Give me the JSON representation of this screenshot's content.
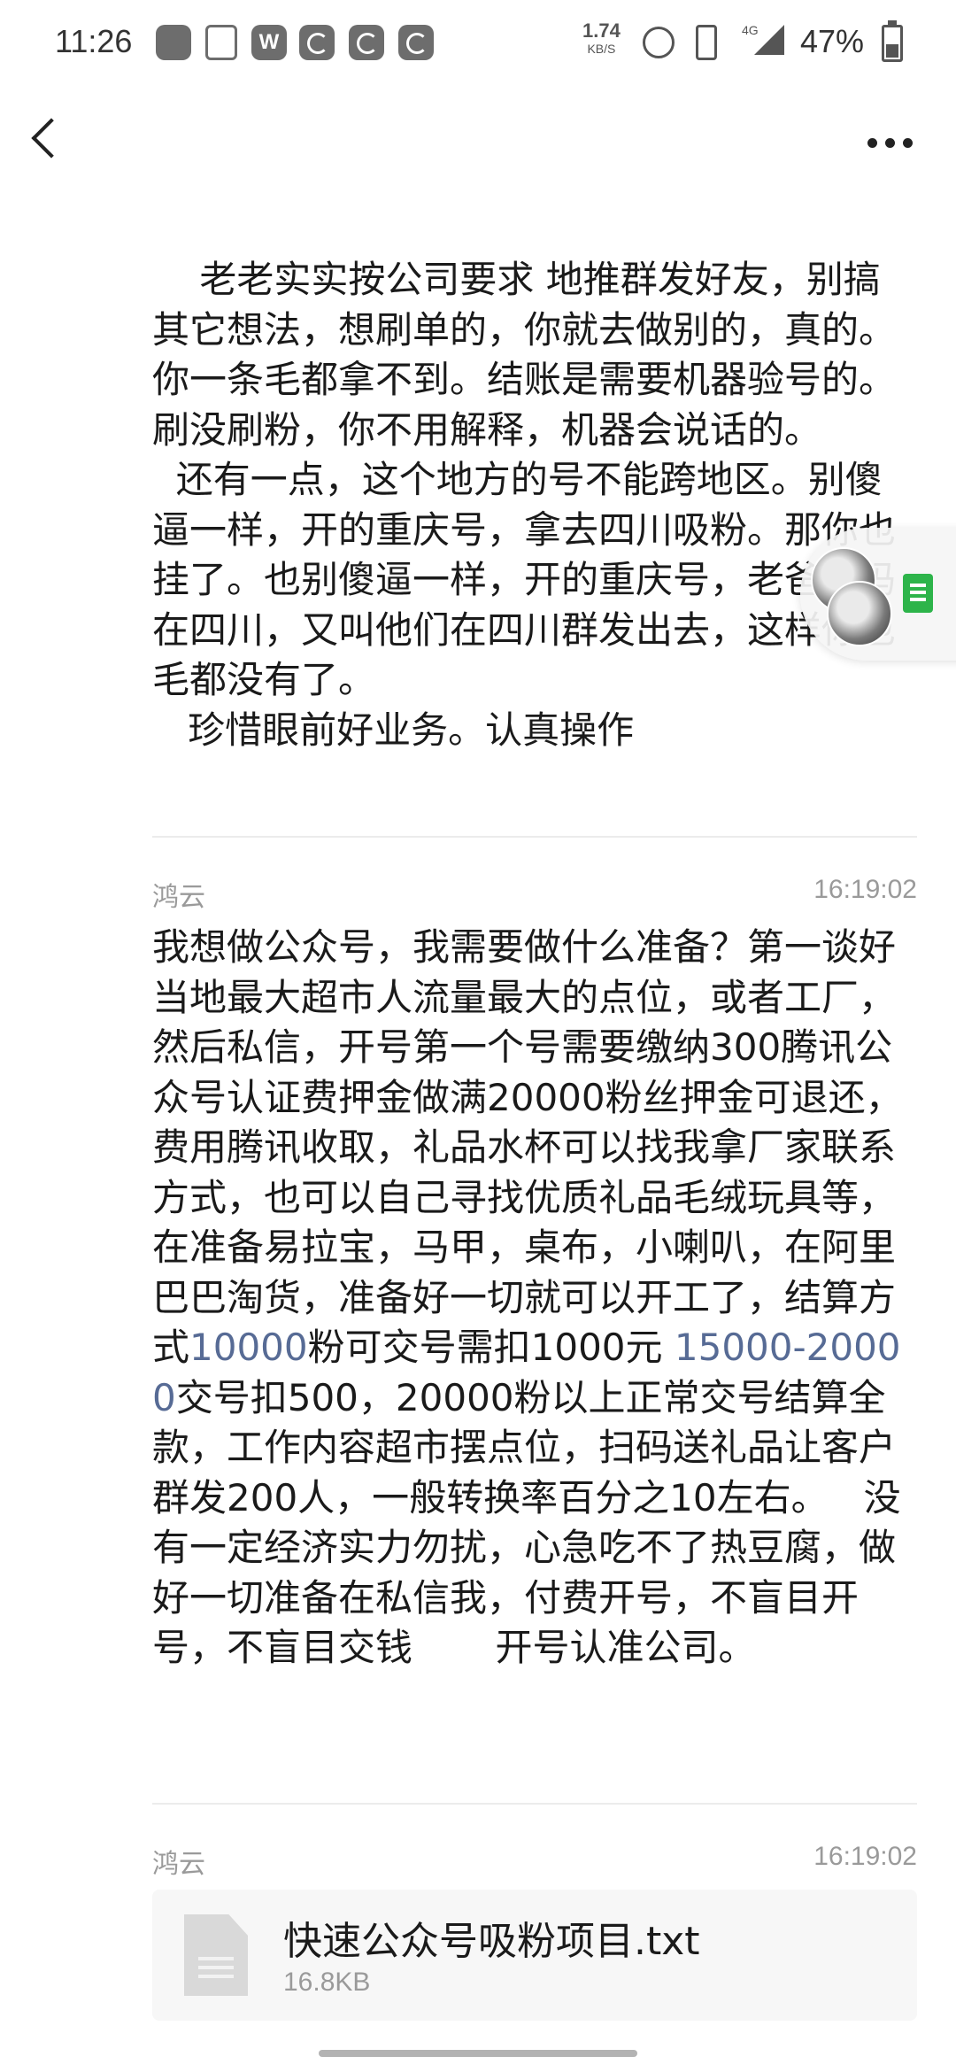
{
  "status_bar": {
    "time": "11:26",
    "net_speed_value": "1.74",
    "net_speed_unit": "KB/S",
    "network_type": "4G",
    "battery_percent": "47%"
  },
  "messages": [
    {
      "text": "    老老实实按公司要求 地推群发好友，别搞其它想法，想刷单的，你就去做别的，真的。你一条毛都拿不到。结账是需要机器验号的。刷没刷粉，你不用解释，机器会说话的。\n  还有一点，这个地方的号不能跨地区。别傻逼一样，开的重庆号，拿去四川吸粉。那你也挂了。也别傻逼一样，开的重庆号，老爸老妈在四川，又叫他们在四川群发出去，这样你也毛都没有了。\n   珍惜眼前好业务。认真操作"
    },
    {
      "sender": "鸿云",
      "time": "16:19:02",
      "text_a": "我想做公众号，我需要做什么准备？第一谈好当地最大超市人流量最大的点位，或者工厂，然后私信，开号第一个号需要缴纳300腾讯公众号认证费押金做满20000粉丝押金可退还，费用腾讯收取，礼品水杯可以找我拿厂家联系方式，也可以自己寻找优质礼品毛绒玩具等，在准备易拉宝，马甲，桌布，小喇叭，在阿里巴巴淘货，准备好一切就可以开工了，结算方式",
      "link_1": "10000",
      "text_b": "粉可交号需扣1000元 ",
      "link_2": "15000-20000",
      "text_c": "交号扣500，20000粉以上正常交号结算全款，工作内容超市摆点位，扫码送礼品让客户群发200人，一般转换率百分之10左右。   没有一定经济实力勿扰，心急吃不了热豆腐，做好一切准备在私信我，付费开号，不盲目开号，不盲目交钱       开号认准公司。"
    },
    {
      "sender": "鸿云",
      "time": "16:19:02",
      "file": {
        "name": "快速公众号吸粉项目.txt",
        "size": "16.8KB"
      }
    }
  ],
  "colors": {
    "link": "#576b95",
    "meta_text": "#9a9a9a",
    "file_card_bg": "#f7f7f7"
  }
}
